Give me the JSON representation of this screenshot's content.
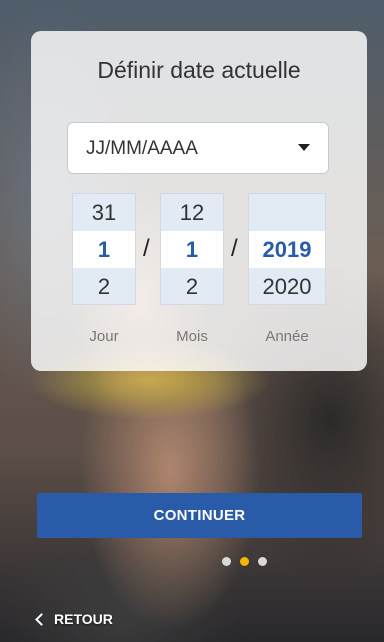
{
  "card": {
    "title": "Définir date actuelle",
    "format_select": {
      "value": "JJ/MM/AAAA",
      "icon": "caret-down-icon"
    },
    "pickers": {
      "day": {
        "prev": "31",
        "current": "1",
        "next": "2",
        "label": "Jour"
      },
      "month": {
        "prev": "12",
        "current": "1",
        "next": "2",
        "label": "Mois"
      },
      "year": {
        "prev": "",
        "current": "2019",
        "next": "2020",
        "label": "Année"
      }
    },
    "separator": "/"
  },
  "continue_button": {
    "label": "CONTINUER"
  },
  "pagination": {
    "total": 3,
    "active_index": 1,
    "colors": {
      "active": "#f2b705",
      "inactive": "#d9d9d9"
    }
  },
  "back_link": {
    "label": "RETOUR",
    "icon": "chevron-left-icon"
  },
  "colors": {
    "accent": "#2a5ba8",
    "picker_bg": "#e2ebf4",
    "card_bg": "rgba(255,255,255,0.82)"
  }
}
